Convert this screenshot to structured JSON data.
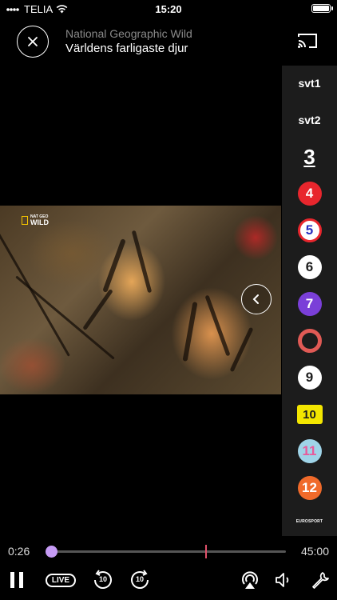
{
  "status_bar": {
    "carrier": "TELIA",
    "time": "15:20"
  },
  "header": {
    "channel_name": "National Geographic Wild",
    "program_title": "Världens farligaste djur"
  },
  "video": {
    "logo_small": "NAT GEO",
    "logo_big": "WILD"
  },
  "channels": [
    {
      "label": "svt1",
      "name": "svt1"
    },
    {
      "label": "svt2",
      "name": "svt2"
    },
    {
      "label": "3",
      "name": "tv3"
    },
    {
      "label": "4",
      "name": "tv4",
      "color": "#e8262d"
    },
    {
      "label": "5",
      "name": "kanal5",
      "color": "#2a2fbf"
    },
    {
      "label": "6",
      "name": "tv6",
      "color": "#ffffff"
    },
    {
      "label": "7",
      "name": "sjuan",
      "color": "#7a3fd8"
    },
    {
      "label": "8",
      "name": "tv8",
      "color": "#e05a55"
    },
    {
      "label": "9",
      "name": "kanal9",
      "color": "#ffffff"
    },
    {
      "label": "10",
      "name": "tv10",
      "color": "#f3e600"
    },
    {
      "label": "11",
      "name": "kanal11",
      "color": "#e85a9a"
    },
    {
      "label": "12",
      "name": "tv12",
      "color": "#f06a2a"
    },
    {
      "label": "EUROSPORT",
      "name": "eurosport"
    }
  ],
  "playback": {
    "elapsed": "0:26",
    "total": "45:00",
    "progress_fraction": 0.0,
    "live_fraction": 0.66
  },
  "controls": {
    "live_label": "LIVE",
    "rewind_seconds": "10",
    "forward_seconds": "10"
  },
  "colors": {
    "accent": "#c69bf5",
    "live_marker": "#e0506a"
  }
}
